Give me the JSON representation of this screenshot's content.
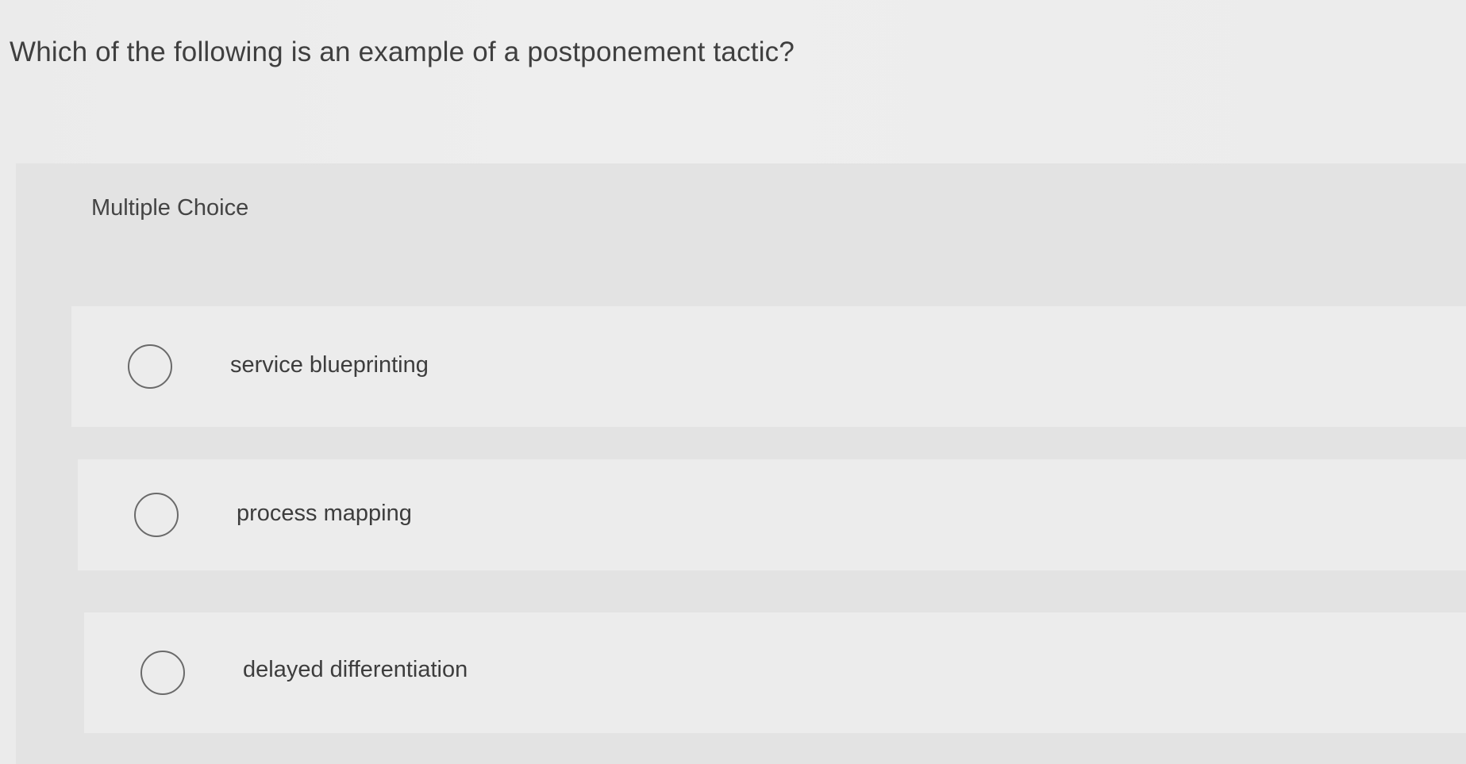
{
  "question": {
    "text": "Which of the following is an example of a postponement tactic?"
  },
  "multiple_choice": {
    "label": "Multiple Choice",
    "options": [
      {
        "label": "service blueprinting",
        "selected": false
      },
      {
        "label": "process mapping",
        "selected": false
      },
      {
        "label": "delayed differentiation",
        "selected": false
      }
    ]
  },
  "colors": {
    "page_background": "#ececec",
    "panel_background": "#e3e3e3",
    "option_background": "#ececec",
    "radio_border": "#6a6a6a",
    "text": "#3d3d3d"
  }
}
